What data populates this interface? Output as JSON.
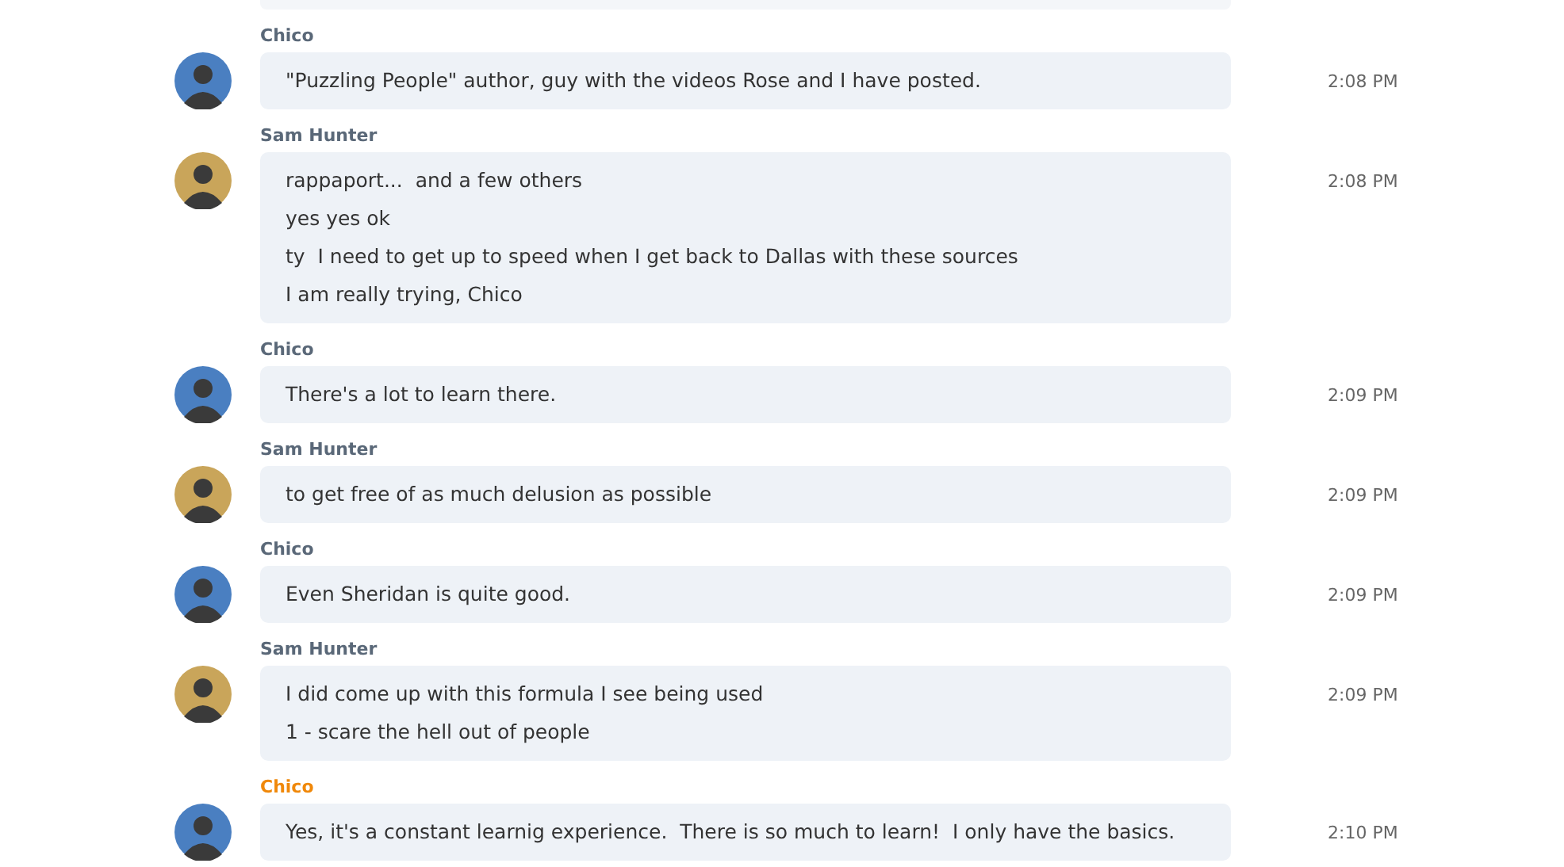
{
  "messages": [
    {
      "sender": "Chico",
      "color": "#4a7fc1",
      "name_highlighted": false,
      "lines": [
        "\"Puzzling People\" author, guy with the videos Rose and I have posted."
      ],
      "time": "2:08 PM"
    },
    {
      "sender": "Sam Hunter",
      "color": "#c9a55a",
      "name_highlighted": false,
      "lines": [
        "rappaport...  and a few others",
        "yes yes ok",
        "ty  I need to get up to speed when I get back to Dallas with these sources",
        "I am really trying, Chico"
      ],
      "time": "2:08 PM"
    },
    {
      "sender": "Chico",
      "color": "#4a7fc1",
      "name_highlighted": false,
      "lines": [
        "There's a lot to learn there."
      ],
      "time": "2:09 PM"
    },
    {
      "sender": "Sam Hunter",
      "color": "#c9a55a",
      "name_highlighted": false,
      "lines": [
        "to get free of as much delusion as possible"
      ],
      "time": "2:09 PM"
    },
    {
      "sender": "Chico",
      "color": "#4a7fc1",
      "name_highlighted": false,
      "lines": [
        "Even Sheridan is quite good."
      ],
      "time": "2:09 PM"
    },
    {
      "sender": "Sam Hunter",
      "color": "#c9a55a",
      "name_highlighted": false,
      "lines": [
        "I did come up with this formula I see being used",
        "1 - scare the hell out of people"
      ],
      "time": "2:09 PM"
    },
    {
      "sender": "Chico",
      "color": "#4a7fc1",
      "name_highlighted": true,
      "lines": [
        "Yes, it's a constant learnig experience.  There is so much to learn!  I only have the basics."
      ],
      "time": "2:10 PM"
    }
  ]
}
